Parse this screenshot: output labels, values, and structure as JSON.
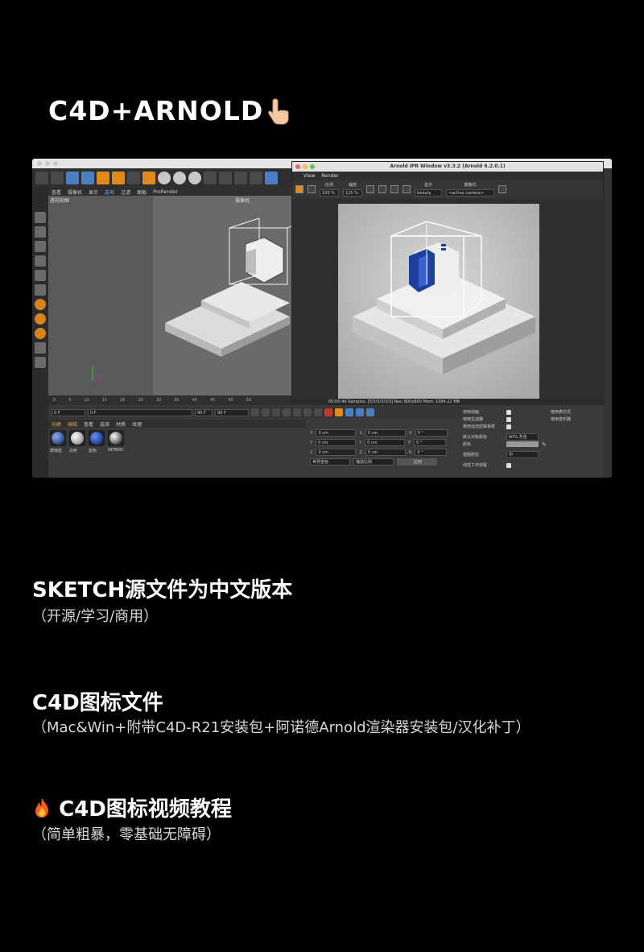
{
  "header": {
    "title": "C4D+ARNOLD",
    "title_icon": "pointing-hand-icon"
  },
  "screenshot": {
    "c4d": {
      "viewport_menu": [
        "查看",
        "摄像机",
        "显示",
        "选项",
        "过滤",
        "面板",
        "ProRender"
      ],
      "viewport_label": "透视视图",
      "camera_label": "摄像机",
      "timeline_ticks": [
        "0",
        "5",
        "10",
        "15",
        "20",
        "25",
        "30",
        "35",
        "40",
        "45",
        "50",
        "55"
      ],
      "frame_start": "0 F",
      "frame_current": "0 F",
      "frame_end_1": "90 F",
      "frame_end_2": "90 F",
      "material_menu": [
        "创建",
        "编辑",
        "查看",
        "选择",
        "材质",
        "纹理"
      ],
      "materials": [
        {
          "label": "玻璃蓝",
          "color": "#2b4c8c"
        },
        {
          "label": "白色",
          "color": "#d8d8d8"
        },
        {
          "label": "蓝色",
          "color": "#1f3f9c"
        },
        {
          "label": "INTERIC",
          "color": "#f0f0f0"
        }
      ],
      "coords": {
        "rows": [
          {
            "axis": "X",
            "pos": "0 cm",
            "axis2": "X",
            "size": "0 cm",
            "axis3": "H",
            "rot": "0 °"
          },
          {
            "axis": "Y",
            "pos": "0 cm",
            "axis2": "Y",
            "size": "0 cm",
            "axis3": "P",
            "rot": "0 °"
          },
          {
            "axis": "Z",
            "pos": "0 cm",
            "axis2": "Z",
            "size": "0 cm",
            "axis3": "B",
            "rot": "0 °"
          }
        ],
        "mode1": "世界坐标",
        "mode2": "缩放比例",
        "apply": "应用"
      },
      "attributes": {
        "rows": [
          {
            "label": "使用动画",
            "right": "使用表达式"
          },
          {
            "label": "使用生成器",
            "right": "使用变形器"
          },
          {
            "label": "使用运动剪辑系统",
            "right": ""
          }
        ],
        "default_color_label": "默认对象颜色",
        "default_color_value": "60% 灰色",
        "color_label": "颜色",
        "view_clip_label": "视图修剪",
        "view_clip_value": "中",
        "linear_label": "线性工作流程"
      }
    },
    "arnold": {
      "title": "Arnold IPR Window v3.3.2 (Arnold 6.2.0.1)",
      "menu": [
        "View",
        "Render"
      ],
      "scale_label": "比例",
      "scale_value": "100 %",
      "zoom_label": "缩放",
      "zoom_value": "125 %",
      "display_label": "显示",
      "display_value": "beauty",
      "camera_label": "摄像机",
      "camera_value": "<active camera>",
      "status": "00:00:44  Samples: [5/3/5/3/3/3]  Res: 800x800  Mem: 1094.22 MB"
    }
  },
  "sections": [
    {
      "title": "SKETCH源文件为中文版本",
      "subtitle": "（开源/学习/商用）"
    },
    {
      "title": "C4D图标文件",
      "subtitle": "（Mac&Win+附带C4D-R21安装包+阿诺德Arnold渲染器安装包/汉化补丁）"
    },
    {
      "title": "C4D图标视频教程",
      "title_icon": "fire-icon",
      "subtitle": "（简单粗暴，零基础无障碍）"
    }
  ]
}
